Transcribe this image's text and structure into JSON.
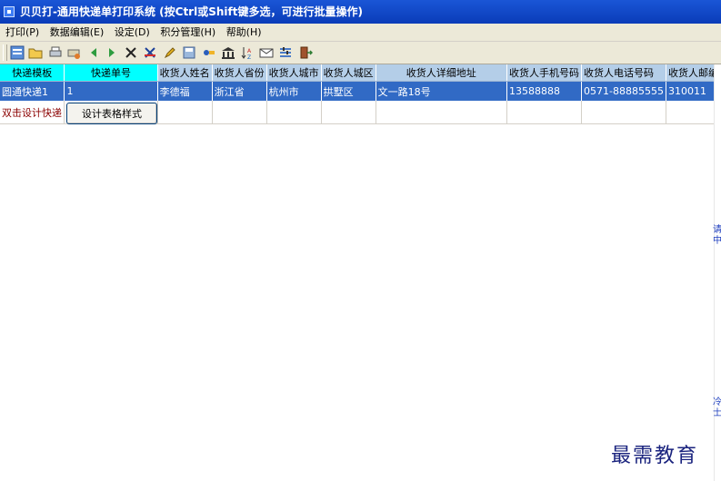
{
  "window": {
    "title": "贝贝打-通用快递单打印系统 (按Ctrl或Shift键多选，可进行批量操作)"
  },
  "menu": [
    "打印(P)",
    "数据编辑(E)",
    "设定(D)",
    "积分管理(H)",
    "帮助(H)"
  ],
  "toolbar_icons": [
    "list-icon",
    "open-folder-icon",
    "print-icon",
    "print-setup-icon",
    "arrow-left-icon",
    "arrow-right-icon",
    "delete-icon",
    "delete-all-icon",
    "edit-icon",
    "save-icon",
    "link-icon",
    "bank-icon",
    "sort-icon",
    "mail-icon",
    "settings-icon",
    "exit-icon"
  ],
  "table": {
    "headers": [
      "快递模板",
      "快递单号",
      "收货人姓名",
      "收货人省份",
      "收货人城市",
      "收货人城区",
      "收货人详细地址",
      "收货人手机号码",
      "收货人电话号码",
      "收货人邮编"
    ],
    "row": [
      "圆通快递1",
      "1",
      "李德福",
      "浙江省",
      "杭州市",
      "拱墅区",
      "文一路18号",
      "13588888",
      "0571-88885555",
      "310011"
    ],
    "hint_text": "双击设计快递"
  },
  "design_button": "设计表格样式",
  "edge_fragments": [
    "请",
    "中",
    "冷",
    "士"
  ],
  "watermark": "最需教育",
  "colors": {
    "title_bar": "#0a3cb8",
    "selected_row": "#316ac5",
    "header_cyan": "#00ffff",
    "header_blue": "#b4cee8"
  }
}
